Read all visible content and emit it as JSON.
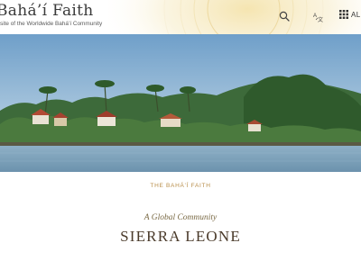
{
  "header": {
    "site_title": "Bahá’í Faith",
    "site_subtitle": "site of the Worldwide Bahá’í Community",
    "search_icon": "search-icon",
    "language_icon": "language-icon",
    "all_sites_icon": "grid-icon",
    "all_sites_label": "AL"
  },
  "hero": {
    "image_subject": "island shoreline with trees and houses",
    "sky_color": "#8fb6d6",
    "water_color": "#7aa0ba"
  },
  "content": {
    "section_label": "THE BAHÁ’Í FAITH",
    "tagline": "A Global Community",
    "country": "SIERRA LEONE"
  },
  "colors": {
    "accent_gold": "#c9a25a",
    "heading": "#4a3a2a"
  }
}
